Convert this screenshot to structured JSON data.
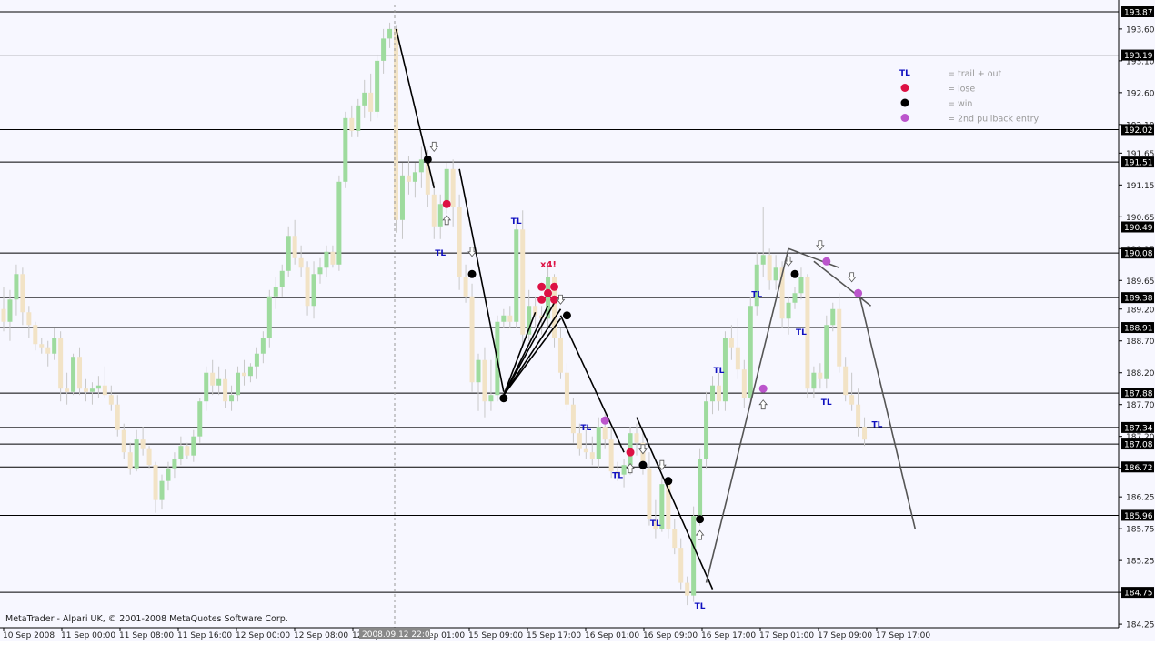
{
  "window": {
    "copyright": "MetaTrader - Alpari UK, © 2001-2008 MetaQuotes Software Corp.",
    "crosshair_time_label": "2008.09.12 22:00"
  },
  "price_axis": {
    "tick_labels": [
      "193.60",
      "193.10",
      "192.60",
      "192.10",
      "191.65",
      "191.15",
      "190.65",
      "190.15",
      "189.65",
      "189.20",
      "188.70",
      "188.20",
      "187.70",
      "187.20",
      "186.70",
      "186.25",
      "185.75",
      "185.25",
      "184.75",
      "184.25"
    ]
  },
  "level_lines": [
    "193.87",
    "193.19",
    "192.02",
    "191.51",
    "190.49",
    "190.08",
    "189.38",
    "188.91",
    "187.88",
    "187.34",
    "187.08",
    "186.72",
    "185.96",
    "184.75"
  ],
  "time_axis": {
    "labels": [
      "10 Sep 2008",
      "11 Sep 00:00",
      "11 Sep 08:00",
      "11 Sep 16:00",
      "12 Sep 00:00",
      "12 Sep 08:00",
      "12 Sep 16:00",
      "15 Sep 01:00",
      "15 Sep 09:00",
      "15 Sep 17:00",
      "16 Sep 01:00",
      "16 Sep 09:00",
      "16 Sep 17:00",
      "17 Sep 01:00",
      "17 Sep 09:00",
      "17 Sep 17:00"
    ]
  },
  "legend": {
    "items": [
      {
        "symbol": "TL",
        "text": "= trail + out",
        "color": "#1010c0"
      },
      {
        "symbol": "dot",
        "text": "= lose",
        "color": "#dd1144"
      },
      {
        "symbol": "dot",
        "text": "= win",
        "color": "#000000"
      },
      {
        "symbol": "dot",
        "text": "= 2nd pullback entry",
        "color": "#bb55cc"
      }
    ]
  },
  "annotations": {
    "tl_text": "TL",
    "x4_text": "x4!"
  },
  "chart_data": {
    "type": "candlestick",
    "instrument_note": "GBPJPY-like price chart, H1 candles",
    "y_range": [
      184.15,
      193.95
    ],
    "colors": {
      "bull": "#9edb9e",
      "bear": "#f2e3c6",
      "wick": "#c8c8c8",
      "level": "#000000",
      "background": "#f7f7ff"
    },
    "candles": [
      [
        189.2,
        189.55,
        188.85,
        189.0
      ],
      [
        189.0,
        189.5,
        188.7,
        189.35
      ],
      [
        189.35,
        189.9,
        189.1,
        189.75
      ],
      [
        189.75,
        189.85,
        188.95,
        189.15
      ],
      [
        189.15,
        189.25,
        188.75,
        188.95
      ],
      [
        188.95,
        189.0,
        188.55,
        188.65
      ],
      [
        188.65,
        188.75,
        188.5,
        188.6
      ],
      [
        188.6,
        188.7,
        188.3,
        188.5
      ],
      [
        188.5,
        188.9,
        188.4,
        188.75
      ],
      [
        188.75,
        188.85,
        187.75,
        187.95
      ],
      [
        187.95,
        188.2,
        187.7,
        187.9
      ],
      [
        187.9,
        188.5,
        187.85,
        188.45
      ],
      [
        188.45,
        188.6,
        187.85,
        187.95
      ],
      [
        187.95,
        188.1,
        187.75,
        187.9
      ],
      [
        187.9,
        188.05,
        187.7,
        187.95
      ],
      [
        187.95,
        188.15,
        187.8,
        188.0
      ],
      [
        188.0,
        188.3,
        187.8,
        187.85
      ],
      [
        187.85,
        188.0,
        187.6,
        187.7
      ],
      [
        187.7,
        187.85,
        187.2,
        187.3
      ],
      [
        187.3,
        187.4,
        186.85,
        186.95
      ],
      [
        186.95,
        187.1,
        186.6,
        186.7
      ],
      [
        186.7,
        187.3,
        186.65,
        187.15
      ],
      [
        187.15,
        187.35,
        186.9,
        187.0
      ],
      [
        187.0,
        187.05,
        186.7,
        186.75
      ],
      [
        186.75,
        186.8,
        186.0,
        186.2
      ],
      [
        186.2,
        186.6,
        186.05,
        186.5
      ],
      [
        186.5,
        186.8,
        186.35,
        186.7
      ],
      [
        186.7,
        186.95,
        186.55,
        186.85
      ],
      [
        186.85,
        187.2,
        186.75,
        187.05
      ],
      [
        187.05,
        187.1,
        186.85,
        186.9
      ],
      [
        186.9,
        187.3,
        186.8,
        187.2
      ],
      [
        187.2,
        187.8,
        187.1,
        187.75
      ],
      [
        187.75,
        188.3,
        187.6,
        188.2
      ],
      [
        188.2,
        188.4,
        187.85,
        188.0
      ],
      [
        188.0,
        188.3,
        187.85,
        188.1
      ],
      [
        188.1,
        188.25,
        187.65,
        187.75
      ],
      [
        187.75,
        188.0,
        187.6,
        187.85
      ],
      [
        187.85,
        188.3,
        187.75,
        188.2
      ],
      [
        188.2,
        188.4,
        188.0,
        188.15
      ],
      [
        188.15,
        188.35,
        188.05,
        188.3
      ],
      [
        188.3,
        188.6,
        188.1,
        188.5
      ],
      [
        188.5,
        188.85,
        188.35,
        188.75
      ],
      [
        188.75,
        189.5,
        188.6,
        189.4
      ],
      [
        189.4,
        189.7,
        189.2,
        189.55
      ],
      [
        189.55,
        189.9,
        189.4,
        189.8
      ],
      [
        189.8,
        190.5,
        189.7,
        190.35
      ],
      [
        190.35,
        190.6,
        189.9,
        190.0
      ],
      [
        190.0,
        190.2,
        189.7,
        189.85
      ],
      [
        189.85,
        189.95,
        189.1,
        189.25
      ],
      [
        189.25,
        189.95,
        189.05,
        189.75
      ],
      [
        189.75,
        190.0,
        189.6,
        189.85
      ],
      [
        189.85,
        190.2,
        189.7,
        190.1
      ],
      [
        190.1,
        190.2,
        189.85,
        189.9
      ],
      [
        189.9,
        191.3,
        189.8,
        191.2
      ],
      [
        191.2,
        192.3,
        191.1,
        192.2
      ],
      [
        192.2,
        192.4,
        191.9,
        192.0
      ],
      [
        192.0,
        192.5,
        191.9,
        192.4
      ],
      [
        192.4,
        192.8,
        192.2,
        192.6
      ],
      [
        192.6,
        192.9,
        192.15,
        192.3
      ],
      [
        192.3,
        193.2,
        192.2,
        193.1
      ],
      [
        193.1,
        193.6,
        192.9,
        193.45
      ],
      [
        193.45,
        193.7,
        193.3,
        193.6
      ],
      [
        193.6,
        193.65,
        190.4,
        190.6
      ],
      [
        190.6,
        191.5,
        190.3,
        191.3
      ],
      [
        191.3,
        191.6,
        191.0,
        191.2
      ],
      [
        191.2,
        191.5,
        190.95,
        191.35
      ],
      [
        191.35,
        191.75,
        191.1,
        191.55
      ],
      [
        191.55,
        191.7,
        190.8,
        191.0
      ],
      [
        191.0,
        191.2,
        190.3,
        190.5
      ],
      [
        190.5,
        191.0,
        190.3,
        190.85
      ],
      [
        190.85,
        191.5,
        190.7,
        191.4
      ],
      [
        191.4,
        191.55,
        190.5,
        190.8
      ],
      [
        190.8,
        191.0,
        189.5,
        189.7
      ],
      [
        189.7,
        189.9,
        189.3,
        189.4
      ],
      [
        189.4,
        189.6,
        187.9,
        188.05
      ],
      [
        188.05,
        188.5,
        187.6,
        188.4
      ],
      [
        188.4,
        188.6,
        187.5,
        187.75
      ],
      [
        187.75,
        188.4,
        187.6,
        187.85
      ],
      [
        187.85,
        189.1,
        187.75,
        189.0
      ],
      [
        189.0,
        189.2,
        188.9,
        189.1
      ],
      [
        189.1,
        189.25,
        188.9,
        189.0
      ],
      [
        189.0,
        190.6,
        188.9,
        190.45
      ],
      [
        190.45,
        190.75,
        188.6,
        188.8
      ],
      [
        188.8,
        189.5,
        188.7,
        189.25
      ],
      [
        189.25,
        189.4,
        188.9,
        189.1
      ],
      [
        189.1,
        189.25,
        188.8,
        189.05
      ],
      [
        189.05,
        189.9,
        188.9,
        189.7
      ],
      [
        189.7,
        189.75,
        188.6,
        188.75
      ],
      [
        188.75,
        188.9,
        188.1,
        188.2
      ],
      [
        188.2,
        188.35,
        187.6,
        187.7
      ],
      [
        187.7,
        187.8,
        187.1,
        187.25
      ],
      [
        187.25,
        187.4,
        186.9,
        187.0
      ],
      [
        187.0,
        187.3,
        186.85,
        186.95
      ],
      [
        186.95,
        187.2,
        186.75,
        186.85
      ],
      [
        186.85,
        187.5,
        186.7,
        187.35
      ],
      [
        187.35,
        187.55,
        187.0,
        187.15
      ],
      [
        187.15,
        187.35,
        186.55,
        186.65
      ],
      [
        186.65,
        186.8,
        186.5,
        186.6
      ],
      [
        186.6,
        186.85,
        186.4,
        186.75
      ],
      [
        186.75,
        187.35,
        186.6,
        187.25
      ],
      [
        187.25,
        187.4,
        186.9,
        187.1
      ],
      [
        187.1,
        187.3,
        186.6,
        186.7
      ],
      [
        186.7,
        186.95,
        185.8,
        185.9
      ],
      [
        185.9,
        186.2,
        185.6,
        185.75
      ],
      [
        185.75,
        186.6,
        185.7,
        186.45
      ],
      [
        186.45,
        186.55,
        185.6,
        185.75
      ],
      [
        185.75,
        185.9,
        185.35,
        185.45
      ],
      [
        185.45,
        185.6,
        184.8,
        184.9
      ],
      [
        184.9,
        185.0,
        184.55,
        184.7
      ],
      [
        184.7,
        186.1,
        184.6,
        185.95
      ],
      [
        185.95,
        187.0,
        185.8,
        186.85
      ],
      [
        186.85,
        187.9,
        186.7,
        187.75
      ],
      [
        187.75,
        188.15,
        187.55,
        188.0
      ],
      [
        188.0,
        188.2,
        187.6,
        187.75
      ],
      [
        187.75,
        188.85,
        187.6,
        188.75
      ],
      [
        188.75,
        188.95,
        188.4,
        188.6
      ],
      [
        188.6,
        189.05,
        188.1,
        188.25
      ],
      [
        188.25,
        188.4,
        187.65,
        187.8
      ],
      [
        187.8,
        189.4,
        187.7,
        189.25
      ],
      [
        189.25,
        190.1,
        189.1,
        189.9
      ],
      [
        189.9,
        190.8,
        189.7,
        190.05
      ],
      [
        190.05,
        190.15,
        189.5,
        189.65
      ],
      [
        189.65,
        190.05,
        189.5,
        189.85
      ],
      [
        189.85,
        189.95,
        188.9,
        189.05
      ],
      [
        189.05,
        189.4,
        188.8,
        189.3
      ],
      [
        189.3,
        189.55,
        189.2,
        189.45
      ],
      [
        189.45,
        189.85,
        189.35,
        189.7
      ],
      [
        189.7,
        189.75,
        187.8,
        187.95
      ],
      [
        187.95,
        188.3,
        187.8,
        188.2
      ],
      [
        188.2,
        188.35,
        187.95,
        188.1
      ],
      [
        188.1,
        189.1,
        187.95,
        188.95
      ],
      [
        188.95,
        189.3,
        188.85,
        189.2
      ],
      [
        189.2,
        189.45,
        188.2,
        188.3
      ],
      [
        188.3,
        188.45,
        187.75,
        187.85
      ],
      [
        187.85,
        188.2,
        187.6,
        187.7
      ],
      [
        187.7,
        187.95,
        187.2,
        187.35
      ],
      [
        187.35,
        187.5,
        187.05,
        187.15
      ]
    ],
    "trend_lines": [
      {
        "from_index": 62,
        "from_price": 193.6,
        "to_index": 68,
        "to_price": 191.1,
        "color": "#000000"
      },
      {
        "from_index": 72,
        "from_price": 191.4,
        "to_index": 79,
        "to_price": 187.9,
        "color": "#000000"
      },
      {
        "from_index": 79,
        "from_price": 187.85,
        "to_index": 88,
        "to_price": 189.05,
        "color": "#000000"
      },
      {
        "from_index": 79,
        "from_price": 187.85,
        "to_index": 88,
        "to_price": 189.2,
        "color": "#000000"
      },
      {
        "from_index": 79,
        "from_price": 187.85,
        "to_index": 87,
        "to_price": 189.3,
        "color": "#000000"
      },
      {
        "from_index": 79,
        "from_price": 187.85,
        "to_index": 86,
        "to_price": 189.25,
        "color": "#000000"
      },
      {
        "from_index": 79,
        "from_price": 187.85,
        "to_index": 84,
        "to_price": 189.15,
        "color": "#000000"
      },
      {
        "from_index": 88,
        "from_price": 189.1,
        "to_index": 98,
        "to_price": 186.95,
        "color": "#000000"
      },
      {
        "from_index": 100,
        "from_price": 187.5,
        "to_index": 112,
        "to_price": 184.8,
        "color": "#000000"
      },
      {
        "from_index": 111,
        "from_price": 184.9,
        "to_index": 124,
        "to_price": 190.15,
        "color": "#555555"
      },
      {
        "from_index": 124,
        "from_price": 190.15,
        "to_index": 132,
        "to_price": 189.85,
        "color": "#555555"
      },
      {
        "from_index": 128,
        "from_price": 189.95,
        "to_index": 137,
        "to_price": 189.25,
        "color": "#555555"
      },
      {
        "from_index": 135,
        "from_price": 189.5,
        "to_index": 144,
        "to_price": 185.75,
        "color": "#555555"
      }
    ],
    "signals": [
      {
        "index": 67,
        "price": 191.55,
        "kind": "win"
      },
      {
        "index": 70,
        "price": 190.85,
        "kind": "lose"
      },
      {
        "index": 74,
        "price": 189.75,
        "kind": "win"
      },
      {
        "index": 79,
        "price": 187.8,
        "kind": "win"
      },
      {
        "index": 85,
        "price": 189.55,
        "kind": "lose"
      },
      {
        "index": 85,
        "price": 189.35,
        "kind": "lose"
      },
      {
        "index": 86,
        "price": 189.45,
        "kind": "lose"
      },
      {
        "index": 87,
        "price": 189.55,
        "kind": "lose"
      },
      {
        "index": 87,
        "price": 189.35,
        "kind": "lose"
      },
      {
        "index": 89,
        "price": 189.1,
        "kind": "win"
      },
      {
        "index": 95,
        "price": 187.45,
        "kind": "pullback"
      },
      {
        "index": 99,
        "price": 186.95,
        "kind": "lose"
      },
      {
        "index": 101,
        "price": 186.75,
        "kind": "win"
      },
      {
        "index": 105,
        "price": 186.5,
        "kind": "win"
      },
      {
        "index": 110,
        "price": 185.9,
        "kind": "win"
      },
      {
        "index": 120,
        "price": 187.95,
        "kind": "pullback"
      },
      {
        "index": 125,
        "price": 189.75,
        "kind": "win"
      },
      {
        "index": 130,
        "price": 189.95,
        "kind": "pullback"
      },
      {
        "index": 135,
        "price": 189.45,
        "kind": "pullback"
      }
    ],
    "tl_markers": [
      {
        "index": 69,
        "price": 190.1
      },
      {
        "index": 81,
        "price": 190.6
      },
      {
        "index": 92,
        "price": 187.35
      },
      {
        "index": 97,
        "price": 186.6
      },
      {
        "index": 103,
        "price": 185.85
      },
      {
        "index": 110,
        "price": 184.55
      },
      {
        "index": 113,
        "price": 188.25
      },
      {
        "index": 119,
        "price": 189.45
      },
      {
        "index": 126,
        "price": 188.85
      },
      {
        "index": 130,
        "price": 187.75
      },
      {
        "index": 138,
        "price": 187.4
      }
    ],
    "arrow_markers": [
      {
        "index": 68,
        "price": 191.75,
        "dir": "down"
      },
      {
        "index": 70,
        "price": 190.6,
        "dir": "up"
      },
      {
        "index": 74,
        "price": 190.1,
        "dir": "down"
      },
      {
        "index": 88,
        "price": 189.35,
        "dir": "down"
      },
      {
        "index": 99,
        "price": 186.7,
        "dir": "up"
      },
      {
        "index": 101,
        "price": 187.0,
        "dir": "down"
      },
      {
        "index": 104,
        "price": 186.75,
        "dir": "down"
      },
      {
        "index": 110,
        "price": 185.65,
        "dir": "up"
      },
      {
        "index": 120,
        "price": 187.7,
        "dir": "up"
      },
      {
        "index": 124,
        "price": 189.95,
        "dir": "down"
      },
      {
        "index": 129,
        "price": 190.2,
        "dir": "down"
      },
      {
        "index": 134,
        "price": 189.7,
        "dir": "down"
      }
    ]
  }
}
